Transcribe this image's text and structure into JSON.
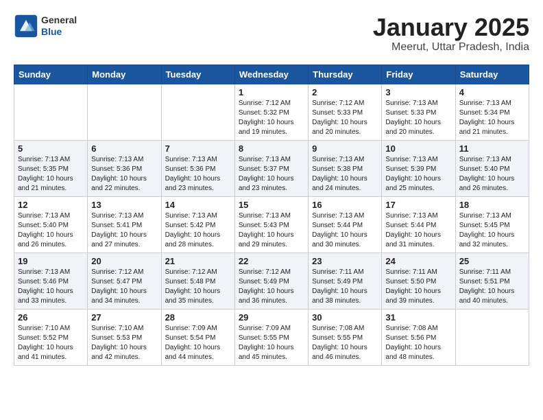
{
  "header": {
    "logo_general": "General",
    "logo_blue": "Blue",
    "month_title": "January 2025",
    "location": "Meerut, Uttar Pradesh, India"
  },
  "weekdays": [
    "Sunday",
    "Monday",
    "Tuesday",
    "Wednesday",
    "Thursday",
    "Friday",
    "Saturday"
  ],
  "weeks": [
    [
      {
        "day": "",
        "info": ""
      },
      {
        "day": "",
        "info": ""
      },
      {
        "day": "",
        "info": ""
      },
      {
        "day": "1",
        "info": "Sunrise: 7:12 AM\nSunset: 5:32 PM\nDaylight: 10 hours\nand 19 minutes."
      },
      {
        "day": "2",
        "info": "Sunrise: 7:12 AM\nSunset: 5:33 PM\nDaylight: 10 hours\nand 20 minutes."
      },
      {
        "day": "3",
        "info": "Sunrise: 7:13 AM\nSunset: 5:33 PM\nDaylight: 10 hours\nand 20 minutes."
      },
      {
        "day": "4",
        "info": "Sunrise: 7:13 AM\nSunset: 5:34 PM\nDaylight: 10 hours\nand 21 minutes."
      }
    ],
    [
      {
        "day": "5",
        "info": "Sunrise: 7:13 AM\nSunset: 5:35 PM\nDaylight: 10 hours\nand 21 minutes."
      },
      {
        "day": "6",
        "info": "Sunrise: 7:13 AM\nSunset: 5:36 PM\nDaylight: 10 hours\nand 22 minutes."
      },
      {
        "day": "7",
        "info": "Sunrise: 7:13 AM\nSunset: 5:36 PM\nDaylight: 10 hours\nand 23 minutes."
      },
      {
        "day": "8",
        "info": "Sunrise: 7:13 AM\nSunset: 5:37 PM\nDaylight: 10 hours\nand 23 minutes."
      },
      {
        "day": "9",
        "info": "Sunrise: 7:13 AM\nSunset: 5:38 PM\nDaylight: 10 hours\nand 24 minutes."
      },
      {
        "day": "10",
        "info": "Sunrise: 7:13 AM\nSunset: 5:39 PM\nDaylight: 10 hours\nand 25 minutes."
      },
      {
        "day": "11",
        "info": "Sunrise: 7:13 AM\nSunset: 5:40 PM\nDaylight: 10 hours\nand 26 minutes."
      }
    ],
    [
      {
        "day": "12",
        "info": "Sunrise: 7:13 AM\nSunset: 5:40 PM\nDaylight: 10 hours\nand 26 minutes."
      },
      {
        "day": "13",
        "info": "Sunrise: 7:13 AM\nSunset: 5:41 PM\nDaylight: 10 hours\nand 27 minutes."
      },
      {
        "day": "14",
        "info": "Sunrise: 7:13 AM\nSunset: 5:42 PM\nDaylight: 10 hours\nand 28 minutes."
      },
      {
        "day": "15",
        "info": "Sunrise: 7:13 AM\nSunset: 5:43 PM\nDaylight: 10 hours\nand 29 minutes."
      },
      {
        "day": "16",
        "info": "Sunrise: 7:13 AM\nSunset: 5:44 PM\nDaylight: 10 hours\nand 30 minutes."
      },
      {
        "day": "17",
        "info": "Sunrise: 7:13 AM\nSunset: 5:44 PM\nDaylight: 10 hours\nand 31 minutes."
      },
      {
        "day": "18",
        "info": "Sunrise: 7:13 AM\nSunset: 5:45 PM\nDaylight: 10 hours\nand 32 minutes."
      }
    ],
    [
      {
        "day": "19",
        "info": "Sunrise: 7:13 AM\nSunset: 5:46 PM\nDaylight: 10 hours\nand 33 minutes."
      },
      {
        "day": "20",
        "info": "Sunrise: 7:12 AM\nSunset: 5:47 PM\nDaylight: 10 hours\nand 34 minutes."
      },
      {
        "day": "21",
        "info": "Sunrise: 7:12 AM\nSunset: 5:48 PM\nDaylight: 10 hours\nand 35 minutes."
      },
      {
        "day": "22",
        "info": "Sunrise: 7:12 AM\nSunset: 5:49 PM\nDaylight: 10 hours\nand 36 minutes."
      },
      {
        "day": "23",
        "info": "Sunrise: 7:11 AM\nSunset: 5:49 PM\nDaylight: 10 hours\nand 38 minutes."
      },
      {
        "day": "24",
        "info": "Sunrise: 7:11 AM\nSunset: 5:50 PM\nDaylight: 10 hours\nand 39 minutes."
      },
      {
        "day": "25",
        "info": "Sunrise: 7:11 AM\nSunset: 5:51 PM\nDaylight: 10 hours\nand 40 minutes."
      }
    ],
    [
      {
        "day": "26",
        "info": "Sunrise: 7:10 AM\nSunset: 5:52 PM\nDaylight: 10 hours\nand 41 minutes."
      },
      {
        "day": "27",
        "info": "Sunrise: 7:10 AM\nSunset: 5:53 PM\nDaylight: 10 hours\nand 42 minutes."
      },
      {
        "day": "28",
        "info": "Sunrise: 7:09 AM\nSunset: 5:54 PM\nDaylight: 10 hours\nand 44 minutes."
      },
      {
        "day": "29",
        "info": "Sunrise: 7:09 AM\nSunset: 5:55 PM\nDaylight: 10 hours\nand 45 minutes."
      },
      {
        "day": "30",
        "info": "Sunrise: 7:08 AM\nSunset: 5:55 PM\nDaylight: 10 hours\nand 46 minutes."
      },
      {
        "day": "31",
        "info": "Sunrise: 7:08 AM\nSunset: 5:56 PM\nDaylight: 10 hours\nand 48 minutes."
      },
      {
        "day": "",
        "info": ""
      }
    ]
  ]
}
